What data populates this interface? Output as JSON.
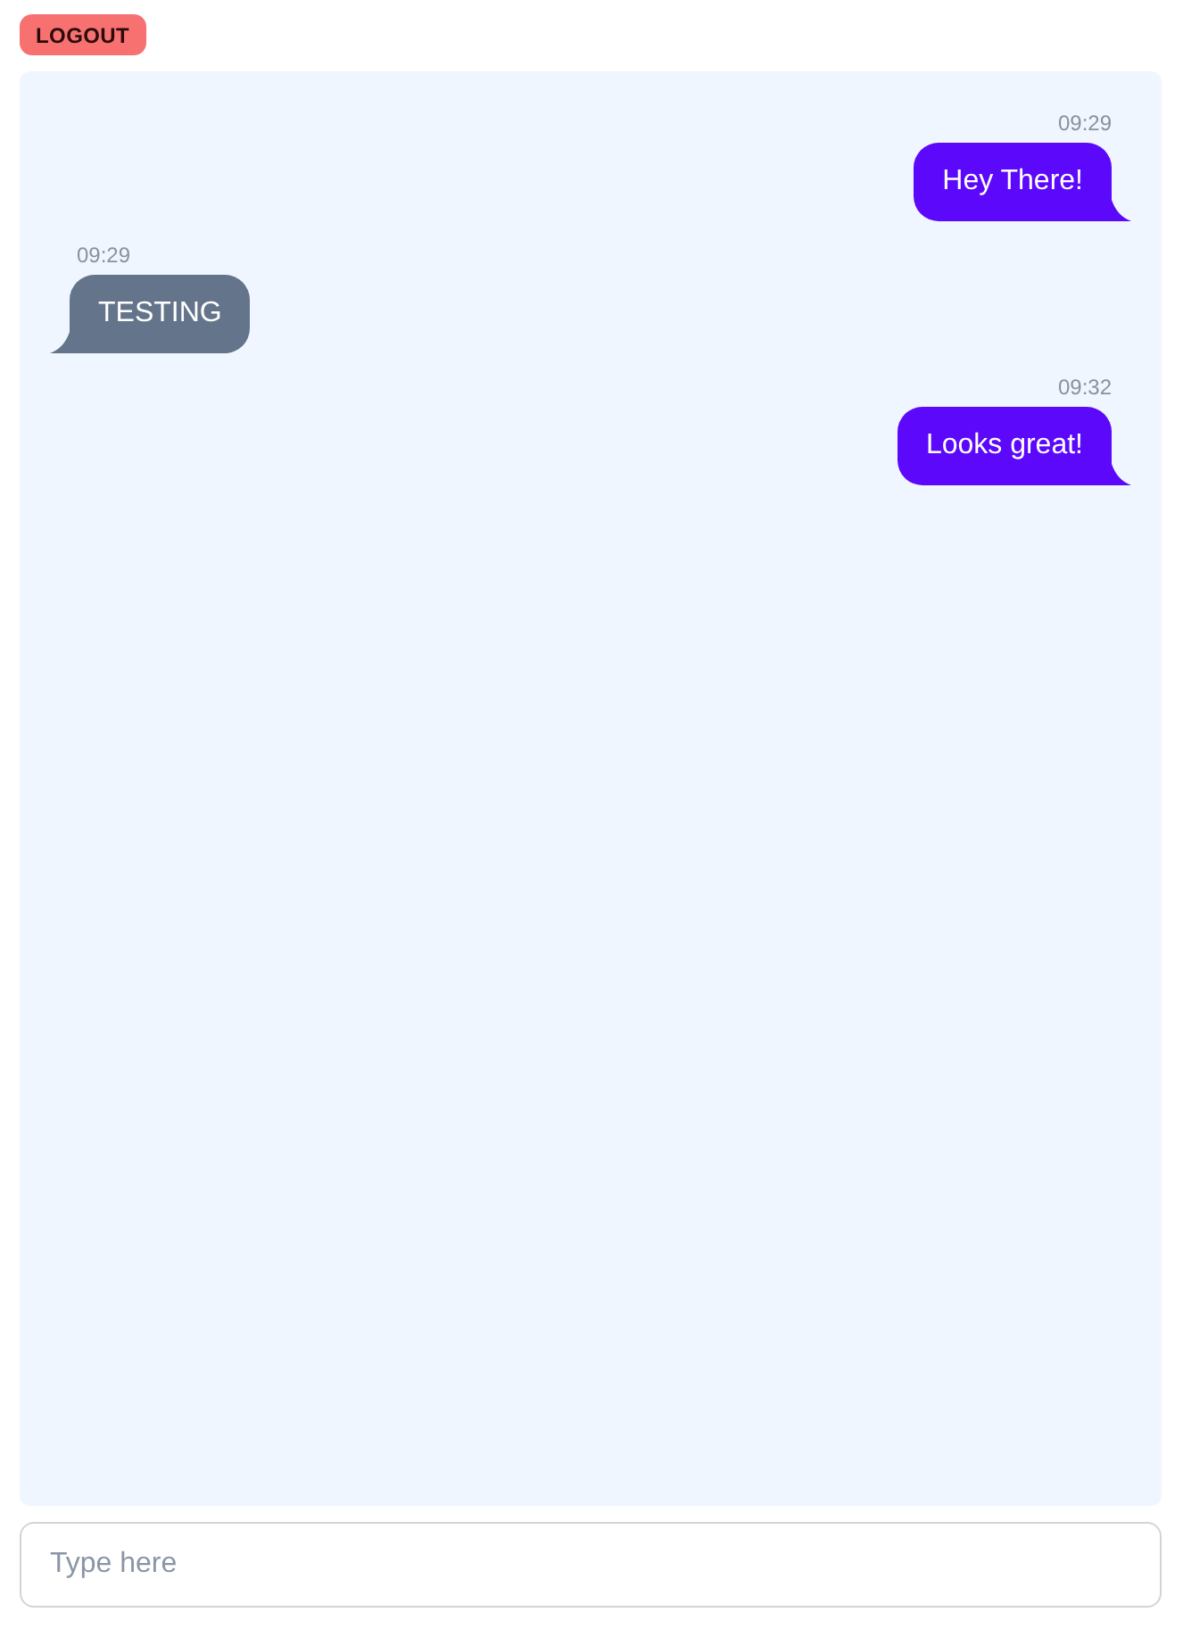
{
  "logout_button": "LOGOUT",
  "messages": [
    {
      "kind": "sent",
      "time": "09:29",
      "text": "Hey There!"
    },
    {
      "kind": "received",
      "time": "09:29",
      "text": "TESTING"
    },
    {
      "kind": "sent",
      "time": "09:32",
      "text": "Looks great!"
    }
  ],
  "composer": {
    "placeholder": "Type here"
  }
}
